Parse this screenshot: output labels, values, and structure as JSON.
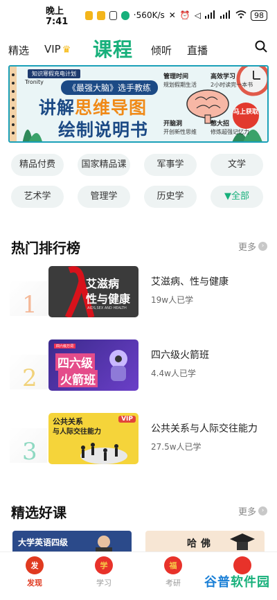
{
  "status_bar": {
    "time": "晚上7:41",
    "speed": "560K/s",
    "battery": "98"
  },
  "top_nav": {
    "items": [
      {
        "label": "精选"
      },
      {
        "label": "VIP"
      },
      {
        "label": "课程",
        "active": true
      },
      {
        "label": "倾听"
      },
      {
        "label": "直播"
      }
    ],
    "accent_color": "#17b07b"
  },
  "banner": {
    "tag": "知识寒假充电计划",
    "logo": "Tronity",
    "subtitle": "《最强大脑》选手教练",
    "title_part1": "讲解",
    "title_highlight": "思维导图",
    "title_line2": "绘制说明书",
    "features": [
      {
        "title": "管理时间",
        "desc": "规划假期生活"
      },
      {
        "title": "高效学习",
        "desc": "2小时读完一本书"
      },
      {
        "title": "开脑洞",
        "desc": "开创新性思维"
      },
      {
        "title": "憋大招",
        "desc": "修炼超强记忆力"
      }
    ],
    "cta": "马上获取"
  },
  "categories": [
    {
      "label": "精品付费"
    },
    {
      "label": "国家精品课"
    },
    {
      "label": "军事学"
    },
    {
      "label": "文学"
    },
    {
      "label": "艺术学"
    },
    {
      "label": "管理学"
    },
    {
      "label": "历史学"
    },
    {
      "label": "全部",
      "icon": "filter-icon"
    }
  ],
  "hot_ranking": {
    "title": "热门排行榜",
    "more": "更多",
    "items": [
      {
        "rank": "1",
        "title": "艾滋病、性与健康",
        "count": "19w人已学",
        "thumb_text": "艾滋病",
        "thumb_text2": "性与健康",
        "thumb_sub": "AIDS,SEX AND HEALTH"
      },
      {
        "rank": "2",
        "title": "四六级火箭班",
        "count": "4.4w人已学",
        "thumb_text": "四六级",
        "thumb_text2": "火箭班",
        "thumb_sub": "四六级万词"
      },
      {
        "rank": "3",
        "title": "公共关系与人际交往能力",
        "count": "27.5w人已学",
        "thumb_text": "公共关系",
        "thumb_text2": "与人际交往能力",
        "thumb_sub": "VIP"
      }
    ]
  },
  "featured": {
    "title": "精选好课",
    "more": "更多",
    "cards": [
      {
        "text": "大学英语四级"
      },
      {
        "text": "哈佛"
      }
    ]
  },
  "bottom_tabs": [
    {
      "label": "发现",
      "active": true,
      "icon_glyph": "发"
    },
    {
      "label": "学习",
      "active": false,
      "icon_glyph": "学"
    },
    {
      "label": "考研",
      "active": false,
      "icon_glyph": "福"
    },
    {
      "label": "",
      "active": false,
      "icon_glyph": ""
    }
  ],
  "watermark": {
    "part1": "谷普",
    "part2": "软件园"
  }
}
